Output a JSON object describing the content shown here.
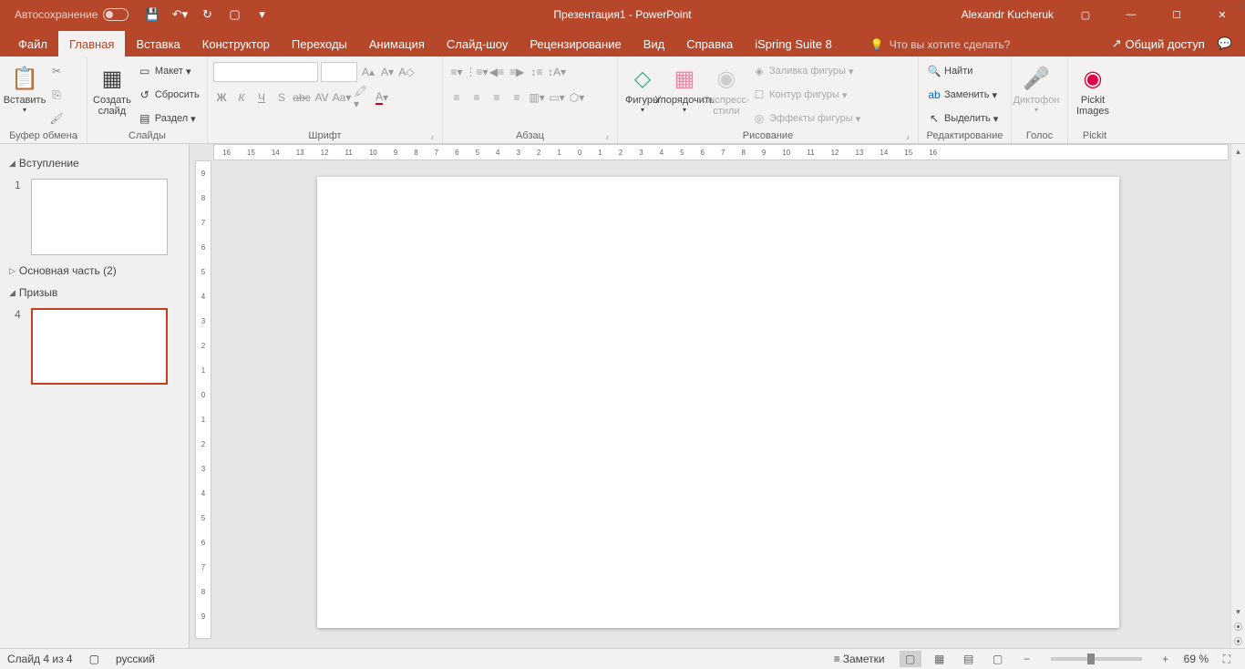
{
  "title": {
    "autosave": "Автосохранение",
    "doc": "Презентация1  -  PowerPoint",
    "user": "Alexandr Kucheruk"
  },
  "tabs": {
    "file": "Файл",
    "home": "Главная",
    "insert": "Вставка",
    "design": "Конструктор",
    "transitions": "Переходы",
    "animations": "Анимация",
    "slideshow": "Слайд-шоу",
    "review": "Рецензирование",
    "view": "Вид",
    "help": "Справка",
    "ispring": "iSpring Suite 8",
    "tellme": "Что вы хотите сделать?",
    "share": "Общий доступ"
  },
  "ribbon": {
    "clipboard": {
      "paste": "Вставить",
      "label": "Буфер обмена"
    },
    "slides": {
      "new": "Создать\nслайд",
      "layout": "Макет",
      "reset": "Сбросить",
      "section": "Раздел",
      "label": "Слайды"
    },
    "font": {
      "label": "Шрифт"
    },
    "paragraph": {
      "label": "Абзац"
    },
    "drawing": {
      "shapes": "Фигуры",
      "arrange": "Упорядочить",
      "quickstyles": "Экспресс-\nстили",
      "fill": "Заливка фигуры",
      "outline": "Контур фигуры",
      "effects": "Эффекты фигуры",
      "label": "Рисование"
    },
    "editing": {
      "find": "Найти",
      "replace": "Заменить",
      "select": "Выделить",
      "label": "Редактирование"
    },
    "voice": {
      "dictate": "Диктофон",
      "label": "Голос"
    },
    "pickit": {
      "btn": "Pickit\nImages",
      "label": "Pickit"
    }
  },
  "sections": {
    "s1": "Вступление",
    "s2": "Основная часть (2)",
    "s3": "Призыв"
  },
  "slides": {
    "n1": "1",
    "n4": "4"
  },
  "rulerH": [
    "16",
    "15",
    "14",
    "13",
    "12",
    "11",
    "10",
    "9",
    "8",
    "7",
    "6",
    "5",
    "4",
    "3",
    "2",
    "1",
    "0",
    "1",
    "2",
    "3",
    "4",
    "5",
    "6",
    "7",
    "8",
    "9",
    "10",
    "11",
    "12",
    "13",
    "14",
    "15",
    "16"
  ],
  "rulerV": [
    "9",
    "8",
    "7",
    "6",
    "5",
    "4",
    "3",
    "2",
    "1",
    "0",
    "1",
    "2",
    "3",
    "4",
    "5",
    "6",
    "7",
    "8",
    "9"
  ],
  "status": {
    "slide": "Слайд 4 из 4",
    "lang": "русский",
    "notes": "Заметки",
    "zoom": "69 %"
  }
}
